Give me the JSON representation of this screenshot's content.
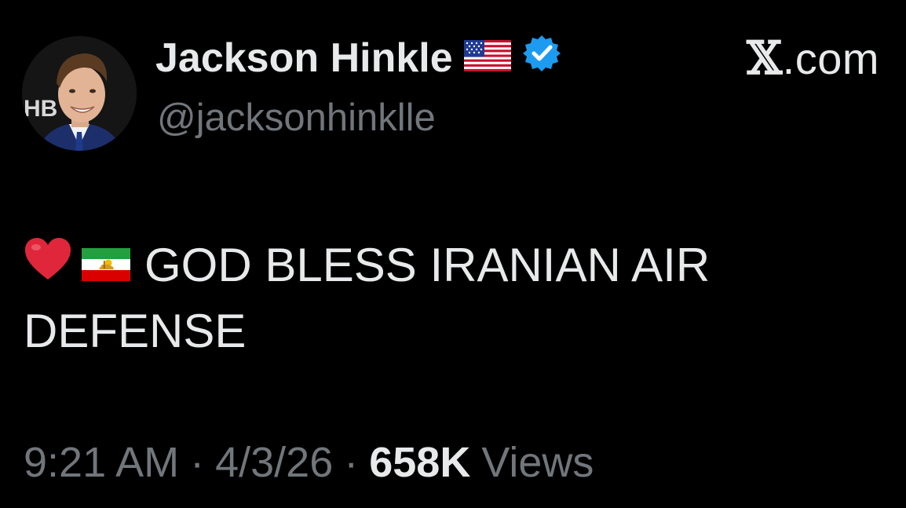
{
  "tweet": {
    "author": {
      "name": "Jackson Hinkle",
      "handle": "@jacksonhinklle",
      "avatar_backdrop_text": "HB",
      "flag_icon": "us-flag-emoji",
      "verified_icon": "verified-badge-icon"
    },
    "brand": {
      "x_glyph": "𝕏",
      "domain": ".com"
    },
    "body": {
      "emoji_1": "heart-emoji",
      "emoji_2": "iran-lion-sun-flag-emoji",
      "line1": "GOD BLESS IRANIAN AIR",
      "line2": "DEFENSE"
    },
    "meta": {
      "time": "9:21 AM",
      "date": "4/3/26",
      "separator": "·",
      "views_count": "658K",
      "views_label": "Views"
    },
    "colors": {
      "background": "#000000",
      "primary_text": "#e7e9ea",
      "secondary_text": "#71767b",
      "verified_blue": "#1d9bf0",
      "heart_red": "#e0263a"
    }
  }
}
